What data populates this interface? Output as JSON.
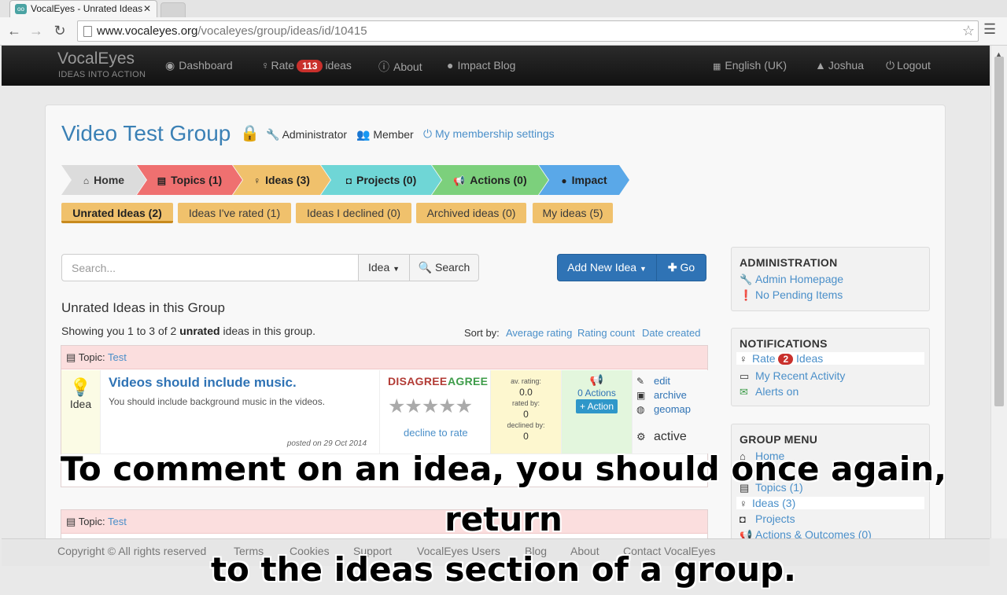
{
  "browser": {
    "tab_title": "VocalEyes - Unrated Ideas",
    "url_domain": "www.vocaleyes.org",
    "url_path": "/vocaleyes/group/ideas/id/10415"
  },
  "topnav": {
    "brand": "VocalEyes",
    "tagline": "IDEAS INTO ACTION",
    "dashboard": "Dashboard",
    "rate_prefix": "Rate",
    "rate_count": "113",
    "rate_suffix": "ideas",
    "about": "About",
    "impact_blog": "Impact Blog",
    "language": "English (UK)",
    "user": "Joshua",
    "logout": "Logout"
  },
  "group": {
    "title": "Video Test Group",
    "role_admin": "Administrator",
    "role_member": "Member",
    "membership_link": "My membership settings"
  },
  "section_tabs": [
    {
      "label": "Home",
      "icon": "home-icon",
      "color": "#dcdcdc"
    },
    {
      "label": "Topics (1)",
      "icon": "list-icon",
      "color": "#ef7070"
    },
    {
      "label": "Ideas (3)",
      "icon": "lightbulb-icon",
      "color": "#f0c16c"
    },
    {
      "label": "Projects (0)",
      "icon": "binoculars-icon",
      "color": "#6fd6d6"
    },
    {
      "label": "Actions (0)",
      "icon": "megaphone-icon",
      "color": "#7cd07c"
    },
    {
      "label": "Impact",
      "icon": "comment-icon",
      "color": "#5aa8e8"
    }
  ],
  "sub_tabs": [
    {
      "label": "Unrated Ideas (2)"
    },
    {
      "label": "Ideas I've rated (1)"
    },
    {
      "label": "Ideas I declined (0)"
    },
    {
      "label": "Archived ideas (0)"
    },
    {
      "label": "My ideas (5)"
    }
  ],
  "search": {
    "placeholder": "Search...",
    "type": "Idea",
    "button": "Search"
  },
  "add_idea": {
    "label": "Add New Idea",
    "go": "Go"
  },
  "list": {
    "heading": "Unrated Ideas in this Group",
    "showing_pre": "Showing you 1 to 3 of 2 ",
    "showing_bold": "unrated",
    "showing_post": " ideas in this group.",
    "sort_label": "Sort by:",
    "sort_options": [
      "Average rating",
      "Rating count",
      "Date created"
    ]
  },
  "ideas": [
    {
      "topic_label": "Topic:",
      "topic": "Test",
      "type": "Idea",
      "title": "Videos should include music.",
      "description": "You should include background music in the videos.",
      "posted": "posted on 29 Oct 2014",
      "disagree": "DISAGREE",
      "agree": "AGREE",
      "decline": "decline to rate",
      "av_rating_label": "av. rating:",
      "av_rating": "0.0",
      "rated_by_label": "rated by:",
      "rated_by": "0",
      "declined_by_label": "declined by:",
      "declined_by": "0",
      "actions_count": "0 Actions",
      "add_action": "+ Action",
      "edit": "edit",
      "archive": "archive",
      "geomap": "geomap",
      "status": "active"
    },
    {
      "topic_label": "Topic:",
      "topic": "Test"
    }
  ],
  "sidebar": {
    "admin_title": "ADMINISTRATION",
    "admin_home": "Admin Homepage",
    "admin_pending": "No Pending Items",
    "notif_title": "NOTIFICATIONS",
    "notif_rate": "Rate",
    "notif_rate_count": "2",
    "notif_ideas": "Ideas",
    "notif_activity": "My Recent Activity",
    "notif_alerts": "Alerts on",
    "menu_title": "GROUP MENU",
    "menu_home": "Home",
    "menu_topics": "Topics (1)",
    "menu_ideas": "Ideas (3)",
    "menu_projects": "Projects",
    "menu_actions": "Actions & Outcomes (0)"
  },
  "footer": {
    "copyright": "Copyright © All rights reserved",
    "links": [
      "Terms",
      "Cookies",
      "Support",
      "VocalEyes Users",
      "Blog",
      "About",
      "Contact VocalEyes"
    ]
  },
  "caption": {
    "line1": "To comment on an idea, you should once again, return",
    "line2": "to the ideas section of a group."
  }
}
